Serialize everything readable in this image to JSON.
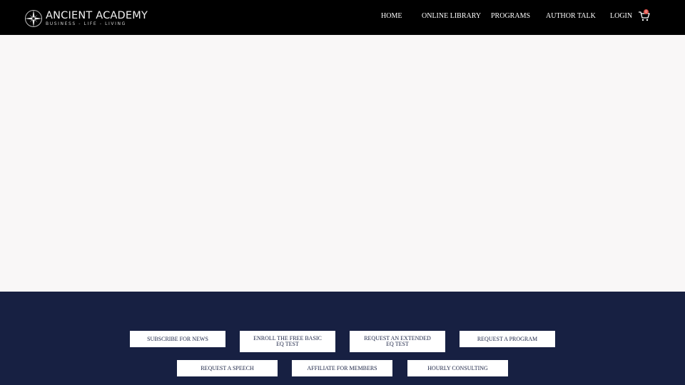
{
  "brand": {
    "name": "ANCIENT ACADEMY",
    "tagline": "BUSINESS - LIFE - LIVING"
  },
  "nav": {
    "home": "HOME",
    "online_library": "ONLINE LIBRARY",
    "programs": "PROGRAMS",
    "author_talk": "AUTHOR TALK",
    "login": "LOGIN",
    "cart_count": "0"
  },
  "footer_buttons": {
    "subscribe": "SUBSCRIBE FOR NEWS",
    "enroll_line1": "ENROLL THE FREE BASIC",
    "enroll_line2": "EQ TEST",
    "extended_line1": "REQUEST AN EXTENDED",
    "extended_line2": "EQ TEST",
    "program": "REQUEST A PROGRAM",
    "speech": "REQUEST A SPEECH",
    "affiliate": "AFFILIATE FOR MEMBERS",
    "consulting": "HOURLY CONSULTING"
  },
  "colors": {
    "header_bg": "#000000",
    "footer_bg": "#172042",
    "page_bg": "#f9f7f7",
    "badge": "#e0534a"
  }
}
